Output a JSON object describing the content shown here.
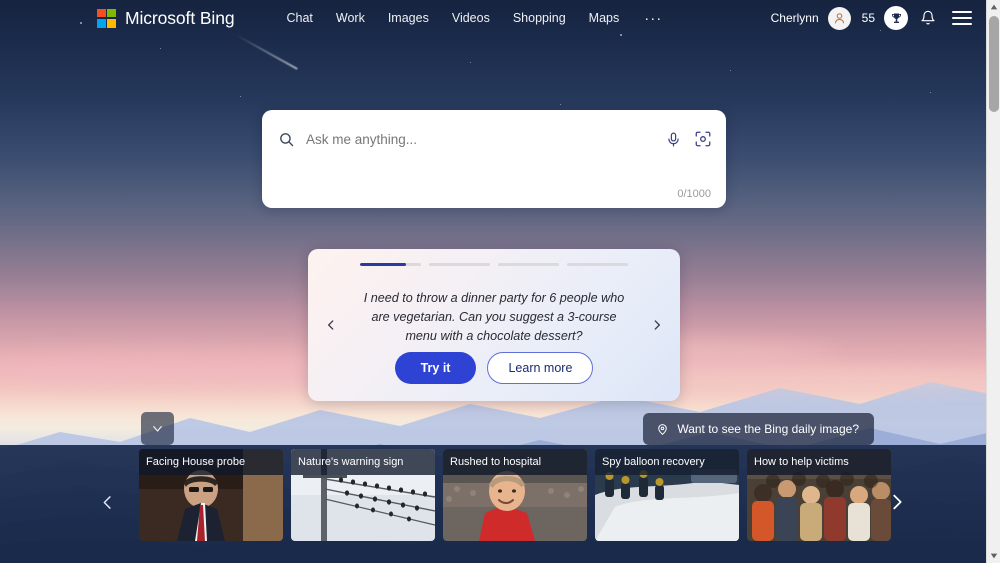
{
  "header": {
    "brand": "Microsoft Bing",
    "logo_icon": "microsoft-squares-logo",
    "logo_colors": [
      "#f25022",
      "#7fba00",
      "#00a4ef",
      "#ffb900"
    ],
    "nav": [
      {
        "label": "Chat"
      },
      {
        "label": "Work"
      },
      {
        "label": "Images"
      },
      {
        "label": "Videos"
      },
      {
        "label": "Shopping"
      },
      {
        "label": "Maps"
      }
    ],
    "more_label": "···",
    "user": {
      "name": "Cherlynn",
      "avatar_icon": "person-avatar-icon",
      "rewards_points": "55",
      "rewards_icon": "trophy-rewards-icon",
      "notifications_icon": "bell-icon",
      "menu_icon": "hamburger-menu-icon"
    }
  },
  "search": {
    "placeholder": "Ask me anything...",
    "value": "",
    "counter": "0/1000",
    "search_icon": "search-icon",
    "mic_icon": "microphone-icon",
    "visual_icon": "visual-search-camera-icon"
  },
  "suggestion": {
    "prompt": "I need to throw a dinner party for 6 people who are vegetarian. Can you suggest a 3-course menu with a chocolate dessert?",
    "try_label": "Try it",
    "learn_label": "Learn more",
    "prev_icon": "chevron-left-icon",
    "next_icon": "chevron-right-icon",
    "progress": [
      75,
      0,
      0,
      0
    ],
    "accent_color": "#2e42d4",
    "progress_fill_color": "#2b3a9c"
  },
  "overlay": {
    "collapse_icon": "chevron-down-icon",
    "daily_image_label": "Want to see the Bing daily image?",
    "daily_image_icon": "location-pin-icon"
  },
  "news": {
    "prev_icon": "chevron-left-icon",
    "next_icon": "chevron-right-icon",
    "cards": [
      {
        "title": "Facing House probe",
        "image": "man-in-suit-glasses-at-hearing"
      },
      {
        "title": "Nature's warning sign",
        "image": "birds-on-power-lines"
      },
      {
        "title": "Rushed to hospital",
        "image": "man-in-red-shirt-at-stadium"
      },
      {
        "title": "Spy balloon recovery",
        "image": "sailors-recovering-balloon-debris"
      },
      {
        "title": "How to help victims",
        "image": "crowd-of-people-receiving-aid"
      }
    ]
  },
  "scrollbar": {
    "up_icon": "scroll-up-arrow-icon",
    "down_icon": "scroll-down-arrow-icon",
    "thumb": "scrollbar-thumb"
  }
}
